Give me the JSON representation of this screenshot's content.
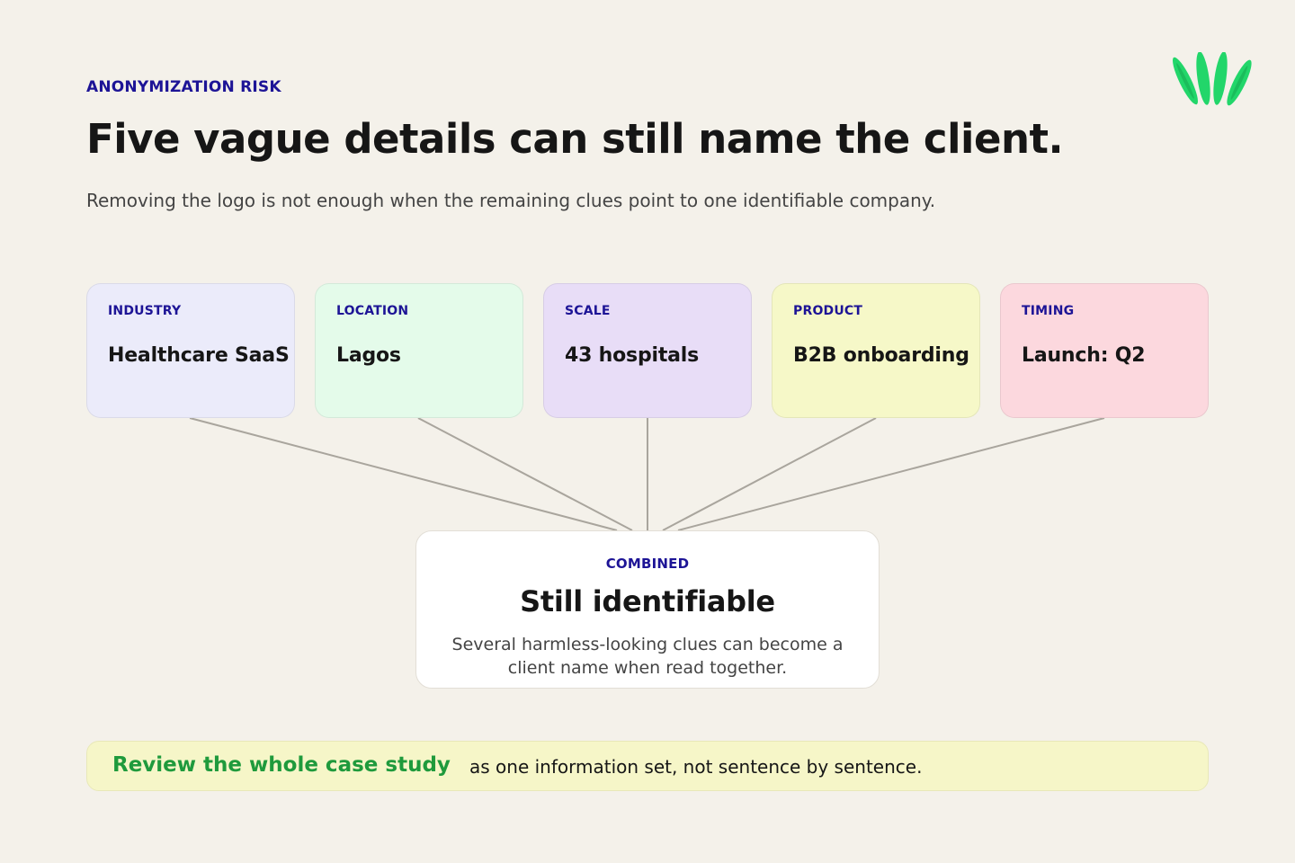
{
  "header": {
    "eyebrow": "ANONYMIZATION RISK",
    "title": "Five vague details can still name the client.",
    "subtitle": "Removing the logo is not enough when the remaining clues point to one identifiable company."
  },
  "logo": {
    "icon": "leaf-sprout-logo-icon",
    "color": "#22d66a"
  },
  "clues": [
    {
      "label": "INDUSTRY",
      "value": "Healthcare SaaS",
      "bg": "#ebebfa"
    },
    {
      "label": "LOCATION",
      "value": "Lagos",
      "bg": "#e4fbea"
    },
    {
      "label": "SCALE",
      "value": "43 hospitals",
      "bg": "#e8ddf7"
    },
    {
      "label": "PRODUCT",
      "value": "B2B onboarding",
      "bg": "#f6f8c8"
    },
    {
      "label": "TIMING",
      "value": "Launch: Q2",
      "bg": "#fcd8de"
    }
  ],
  "combined": {
    "label": "COMBINED",
    "title": "Still identifiable",
    "body": "Several harmless-looking clues can become a client name when read together."
  },
  "banner": {
    "strong": "Review the whole case study",
    "rest": "as one information set, not sentence by sentence."
  },
  "colors": {
    "accent_text": "#1d1496",
    "highlight_green": "#1f9a3c",
    "connector": "#a9a59d",
    "background": "#f4f1ea"
  }
}
